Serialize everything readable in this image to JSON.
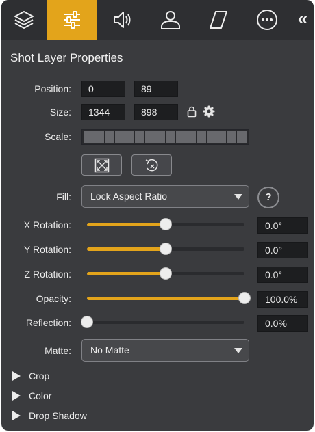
{
  "header": {
    "tabs": [
      {
        "icon": "layers-icon",
        "active": false
      },
      {
        "icon": "sliders-icon",
        "active": true
      },
      {
        "icon": "speaker-icon",
        "active": false
      },
      {
        "icon": "person-icon",
        "active": false
      },
      {
        "icon": "parallelogram-icon",
        "active": false
      },
      {
        "icon": "more-icon",
        "active": false
      }
    ],
    "collapse_label": "«"
  },
  "panel": {
    "title": "Shot Layer Properties",
    "position": {
      "label": "Position:",
      "x": "0",
      "y": "89"
    },
    "size": {
      "label": "Size:",
      "width": "1344",
      "height": "898"
    },
    "scale": {
      "label": "Scale:"
    },
    "fill": {
      "label": "Fill:",
      "value": "Lock Aspect Ratio",
      "help_label": "?"
    },
    "x_rotation": {
      "label": "X Rotation:",
      "value": "0.0°",
      "fraction": 0.5
    },
    "y_rotation": {
      "label": "Y Rotation:",
      "value": "0.0°",
      "fraction": 0.5
    },
    "z_rotation": {
      "label": "Z Rotation:",
      "value": "0.0°",
      "fraction": 0.5
    },
    "opacity": {
      "label": "Opacity:",
      "value": "100.0%",
      "fraction": 1.0
    },
    "reflection": {
      "label": "Reflection:",
      "value": "0.0%",
      "fraction": 0.0
    },
    "matte": {
      "label": "Matte:",
      "value": "No Matte"
    },
    "sections": {
      "crop": "Crop",
      "color": "Color",
      "drop_shadow": "Drop Shadow"
    }
  },
  "colors": {
    "accent": "#e3a41b",
    "panel_bg": "#3a3b3e",
    "tab_bar_bg": "#2e2f32"
  }
}
